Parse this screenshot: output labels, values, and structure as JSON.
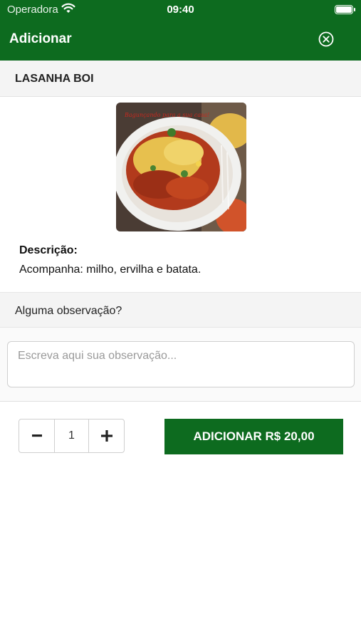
{
  "status_bar": {
    "carrier": "Operadora",
    "time": "09:40"
  },
  "nav": {
    "title": "Adicionar",
    "close_icon": "close-circle-icon"
  },
  "product": {
    "name": "LASANHA BOI",
    "image_caption": "Bagunçando para a sua casa!",
    "description_label": "Descrição:",
    "description": "Acompanha: milho, ervilha e batata."
  },
  "observation": {
    "label": "Alguma observação?",
    "placeholder": "Escreva aqui sua observação...",
    "value": ""
  },
  "quantity": {
    "minus_label": "−",
    "value": "1",
    "plus_label": "+"
  },
  "add_button": {
    "label": "ADICIONAR R$ 20,00"
  },
  "colors": {
    "brand_green": "#0d6b1f",
    "section_bg": "#f4f4f4"
  }
}
